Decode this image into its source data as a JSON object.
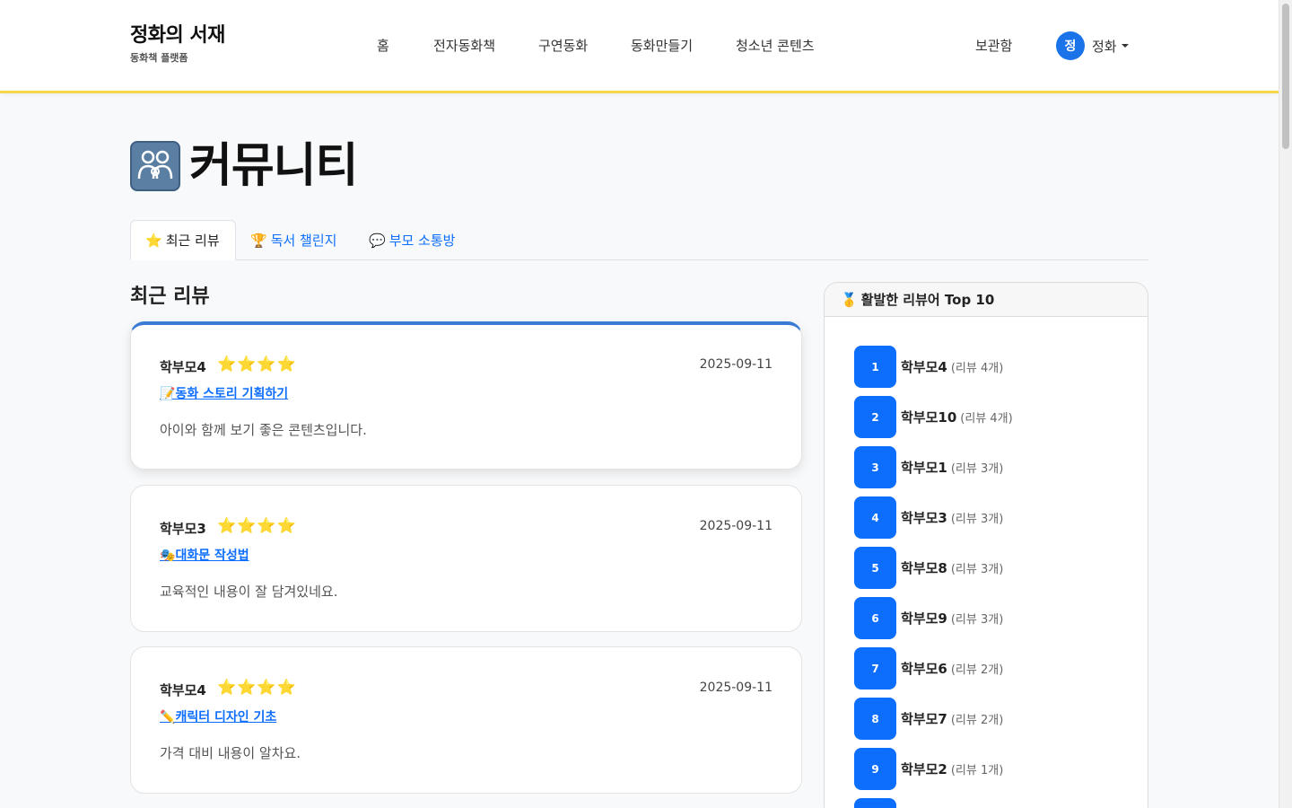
{
  "header": {
    "brand_title": "정화의 서재",
    "brand_subtitle": "동화책 플랫폼",
    "nav": [
      "홈",
      "전자동화책",
      "구연동화",
      "동화만들기",
      "청소년 콘텐츠"
    ],
    "storage": "보관함",
    "user_initial": "정",
    "user_name": "정화"
  },
  "page": {
    "title_icon": "family-icon",
    "title": "커뮤니티"
  },
  "tabs": [
    {
      "icon": "⭐",
      "label": "최근 리뷰",
      "active": true
    },
    {
      "icon": "🏆",
      "label": "독서 챌린지",
      "active": false
    },
    {
      "icon": "💬",
      "label": "부모 소통방",
      "active": false
    }
  ],
  "reviews_section": {
    "title": "최근 리뷰",
    "reviews": [
      {
        "author": "학부모4",
        "stars": "⭐⭐⭐⭐",
        "rating": 4,
        "date": "2025-09-11",
        "link_icon": "📝",
        "link": "동화 스토리 기획하기",
        "body": "아이와 함께 보기 좋은 콘텐츠입니다."
      },
      {
        "author": "학부모3",
        "stars": "⭐⭐⭐⭐",
        "rating": 4,
        "date": "2025-09-11",
        "link_icon": "🎭",
        "link": "대화문 작성법",
        "body": "교육적인 내용이 잘 담겨있네요."
      },
      {
        "author": "학부모4",
        "stars": "⭐⭐⭐⭐",
        "rating": 4,
        "date": "2025-09-11",
        "link_icon": "✏️",
        "link": "캐릭터 디자인 기초",
        "body": "가격 대비 내용이 알차요."
      }
    ]
  },
  "sidebar": {
    "title_icon": "🥇",
    "title": "활발한 리뷰어 Top 10",
    "reviewers": [
      {
        "rank": "1",
        "name": "학부모4",
        "count": "(리뷰 4개)"
      },
      {
        "rank": "2",
        "name": "학부모10",
        "count": "(리뷰 4개)"
      },
      {
        "rank": "3",
        "name": "학부모1",
        "count": "(리뷰 3개)"
      },
      {
        "rank": "4",
        "name": "학부모3",
        "count": "(리뷰 3개)"
      },
      {
        "rank": "5",
        "name": "학부모8",
        "count": "(리뷰 3개)"
      },
      {
        "rank": "6",
        "name": "학부모9",
        "count": "(리뷰 3개)"
      },
      {
        "rank": "7",
        "name": "학부모6",
        "count": "(리뷰 2개)"
      },
      {
        "rank": "8",
        "name": "학부모7",
        "count": "(리뷰 2개)"
      },
      {
        "rank": "9",
        "name": "학부모2",
        "count": "(리뷰 1개)"
      }
    ]
  },
  "colors": {
    "accent_blue": "#0d6efd",
    "header_border": "#f5d74a",
    "star": "#f5b301"
  }
}
